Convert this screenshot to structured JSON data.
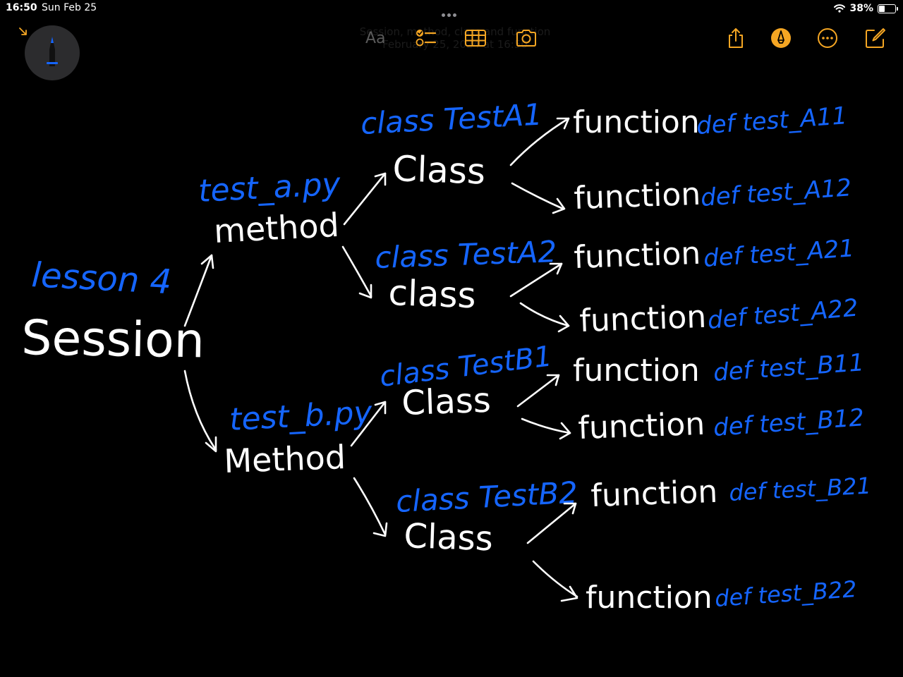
{
  "status_bar": {
    "time": "16:50",
    "date": "Sun Feb 25",
    "battery_percent": "38%",
    "battery_level": 0.38
  },
  "note": {
    "title": "Session, method, class and function",
    "subtitle": "February 25, 2024 at 16:50"
  },
  "toolbar": {
    "format_label": "Aa",
    "icons": [
      "checklist-icon",
      "table-icon",
      "camera-icon",
      "share-icon",
      "markup-icon",
      "more-icon",
      "compose-icon"
    ]
  },
  "colors": {
    "background": "#000000",
    "white_ink": "#ffffff",
    "blue_ink": "#1565ff",
    "accent": "#f5a623"
  },
  "diagram": {
    "root": {
      "label": "Session",
      "note": "lesson 4"
    },
    "modules": [
      {
        "label": "method",
        "note": "test_a.py",
        "classes": [
          {
            "label": "Class",
            "note": "class TestA1",
            "functions": [
              {
                "label": "function",
                "note": "def test_A11"
              },
              {
                "label": "function",
                "note": "def test_A12"
              }
            ]
          },
          {
            "label": "class",
            "note": "class TestA2",
            "functions": [
              {
                "label": "function",
                "note": "def test_A21"
              },
              {
                "label": "function",
                "note": "def test_A22"
              }
            ]
          }
        ]
      },
      {
        "label": "Method",
        "note": "test_b.py",
        "classes": [
          {
            "label": "Class",
            "note": "class TestB1",
            "functions": [
              {
                "label": "function",
                "note": "def test_B11"
              },
              {
                "label": "function",
                "note": "def test_B12"
              }
            ]
          },
          {
            "label": "Class",
            "note": "class TestB2",
            "functions": [
              {
                "label": "function",
                "note": "def test_B21"
              },
              {
                "label": "function",
                "note": "def test_B22"
              }
            ]
          }
        ]
      }
    ]
  }
}
